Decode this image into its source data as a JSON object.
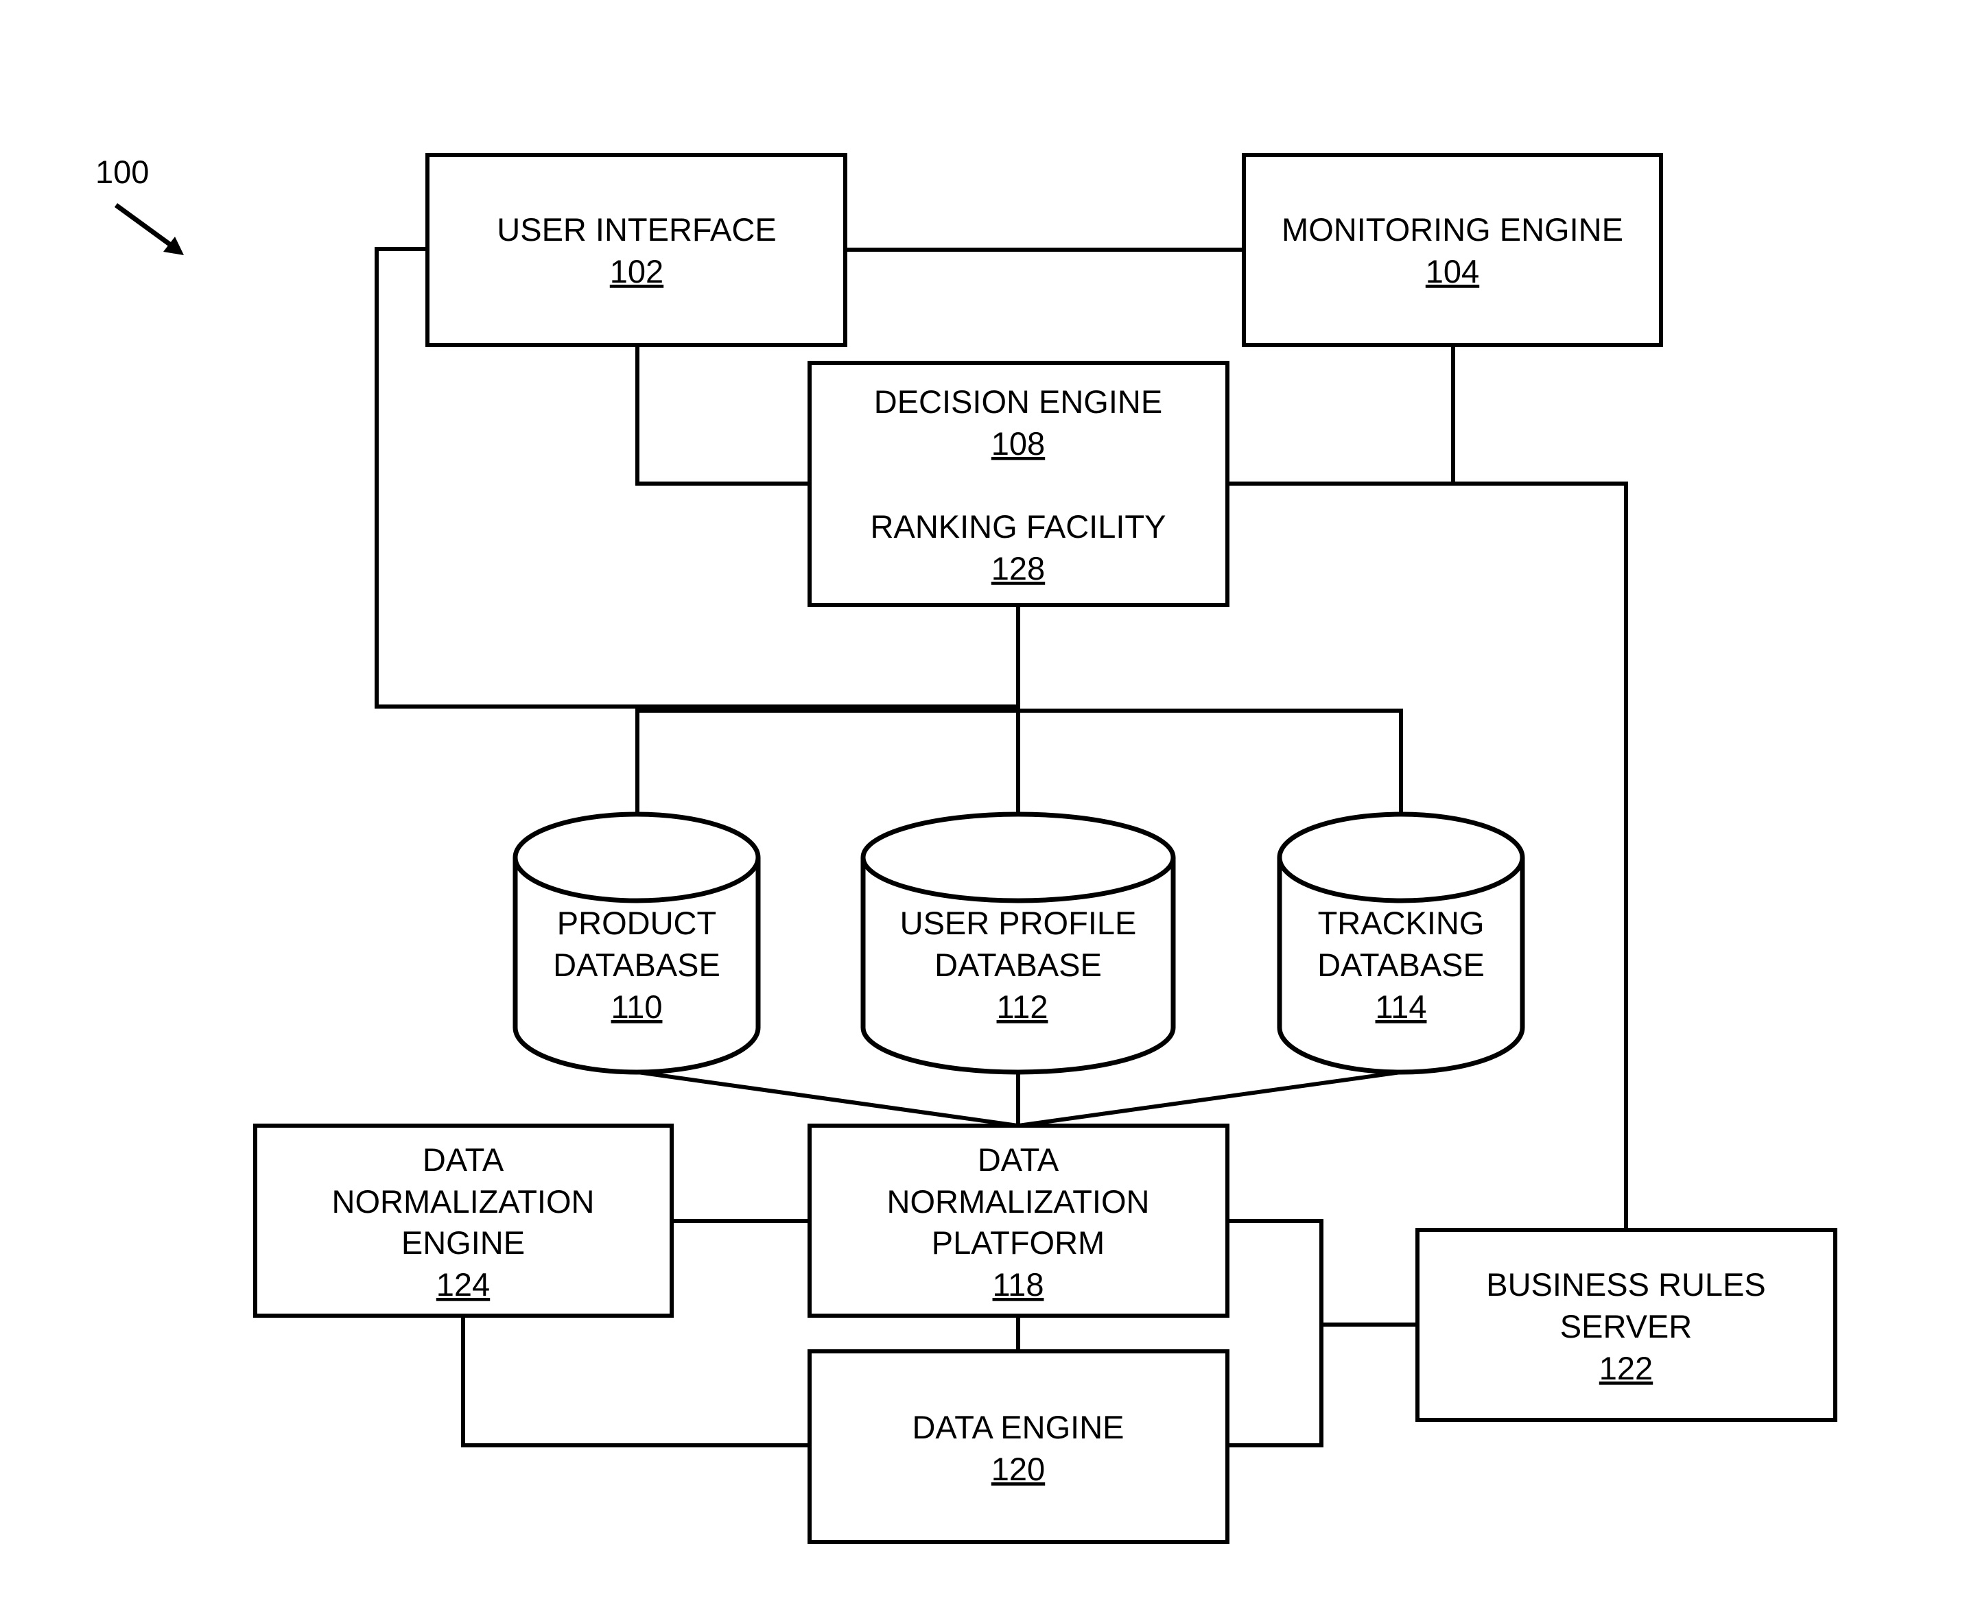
{
  "figure": {
    "reference": "100"
  },
  "components": {
    "user_interface": {
      "lines": [
        "USER INTERFACE"
      ],
      "ref": "102"
    },
    "monitoring_engine": {
      "lines": [
        "MONITORING ENGINE"
      ],
      "ref": "104"
    },
    "decision_engine": {
      "lines": [
        "DECISION ENGINE"
      ],
      "ref": "108"
    },
    "ranking_facility": {
      "lines": [
        "RANKING FACILITY"
      ],
      "ref": "128"
    },
    "product_database": {
      "lines": [
        "PRODUCT",
        "DATABASE"
      ],
      "ref": "110"
    },
    "user_profile_database": {
      "lines": [
        "USER PROFILE",
        "DATABASE"
      ],
      "ref": "112"
    },
    "tracking_database": {
      "lines": [
        "TRACKING",
        "DATABASE"
      ],
      "ref": "114"
    },
    "data_normalization_engine": {
      "lines": [
        "DATA",
        "NORMALIZATION",
        "ENGINE"
      ],
      "ref": "124"
    },
    "data_normalization_platform": {
      "lines": [
        "DATA",
        "NORMALIZATION",
        "PLATFORM"
      ],
      "ref": "118"
    },
    "data_engine": {
      "lines": [
        "DATA ENGINE"
      ],
      "ref": "120"
    },
    "business_rules_server": {
      "lines": [
        "BUSINESS RULES",
        "SERVER"
      ],
      "ref": "122"
    }
  },
  "connections": [
    [
      "user_interface",
      "monitoring_engine"
    ],
    [
      "user_interface",
      "decision_engine"
    ],
    [
      "user_interface",
      "product_database"
    ],
    [
      "user_interface",
      "user_profile_database"
    ],
    [
      "user_interface",
      "tracking_database"
    ],
    [
      "monitoring_engine",
      "decision_engine"
    ],
    [
      "decision_engine",
      "business_rules_server"
    ],
    [
      "decision_engine",
      "product_database"
    ],
    [
      "decision_engine",
      "user_profile_database"
    ],
    [
      "decision_engine",
      "tracking_database"
    ],
    [
      "product_database",
      "data_normalization_platform"
    ],
    [
      "user_profile_database",
      "data_normalization_platform"
    ],
    [
      "tracking_database",
      "data_normalization_platform"
    ],
    [
      "data_normalization_engine",
      "data_normalization_platform"
    ],
    [
      "data_normalization_platform",
      "data_engine"
    ],
    [
      "data_normalization_engine",
      "data_engine"
    ],
    [
      "data_normalization_platform",
      "business_rules_server"
    ],
    [
      "data_engine",
      "business_rules_server"
    ]
  ]
}
